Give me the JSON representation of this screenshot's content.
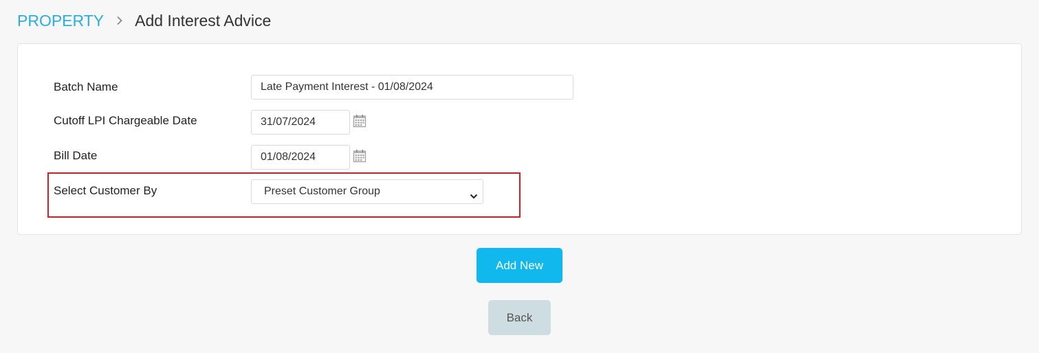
{
  "breadcrumb": {
    "root": "PROPERTY",
    "current": "Add Interest Advice"
  },
  "form": {
    "batch_name": {
      "label": "Batch Name",
      "value": "Late Payment Interest - 01/08/2024"
    },
    "cutoff_date": {
      "label": "Cutoff LPI Chargeable Date",
      "value": "31/07/2024"
    },
    "bill_date": {
      "label": "Bill Date",
      "value": "01/08/2024"
    },
    "select_customer_by": {
      "label": "Select Customer By",
      "selected": "Preset Customer Group"
    }
  },
  "buttons": {
    "add_new": "Add New",
    "back": "Back"
  },
  "colors": {
    "accent": "#10b8ee",
    "link": "#2aaee0",
    "highlight": "#e01b24",
    "back_button": "#cddde1"
  },
  "icons": {
    "breadcrumb_separator": "chevron-right-icon",
    "date_picker": "calendar-icon",
    "select": "chevron-down-icon"
  }
}
